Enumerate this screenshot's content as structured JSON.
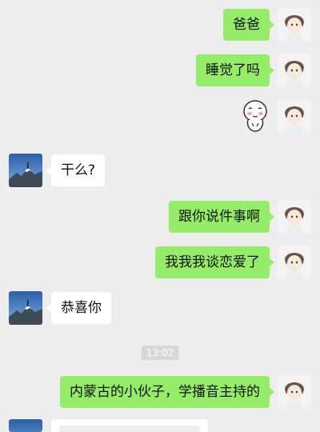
{
  "messages": [
    {
      "sender": "me",
      "text": "爸爸"
    },
    {
      "sender": "me",
      "text": "睡觉了吗"
    },
    {
      "sender": "me",
      "sticker": "blushing-face-sticker"
    },
    {
      "sender": "friend",
      "text": "干么?"
    },
    {
      "sender": "me",
      "text": "跟你说件事啊"
    },
    {
      "sender": "me",
      "text": "我我我谈恋爱了"
    },
    {
      "sender": "friend",
      "text": "恭喜你"
    },
    {
      "sender": "me",
      "text": "内蒙古的小伙子，学播音主持的"
    }
  ],
  "timestamp": "13:02",
  "colors": {
    "background": "#ededed",
    "my_bubble": "#95ec69",
    "friend_bubble": "#ffffff",
    "timestamp_bg": "#d7d7d7"
  },
  "icons": {
    "my_avatar": "anime-character-avatar",
    "friend_avatar": "mountain-landscape-avatar"
  }
}
